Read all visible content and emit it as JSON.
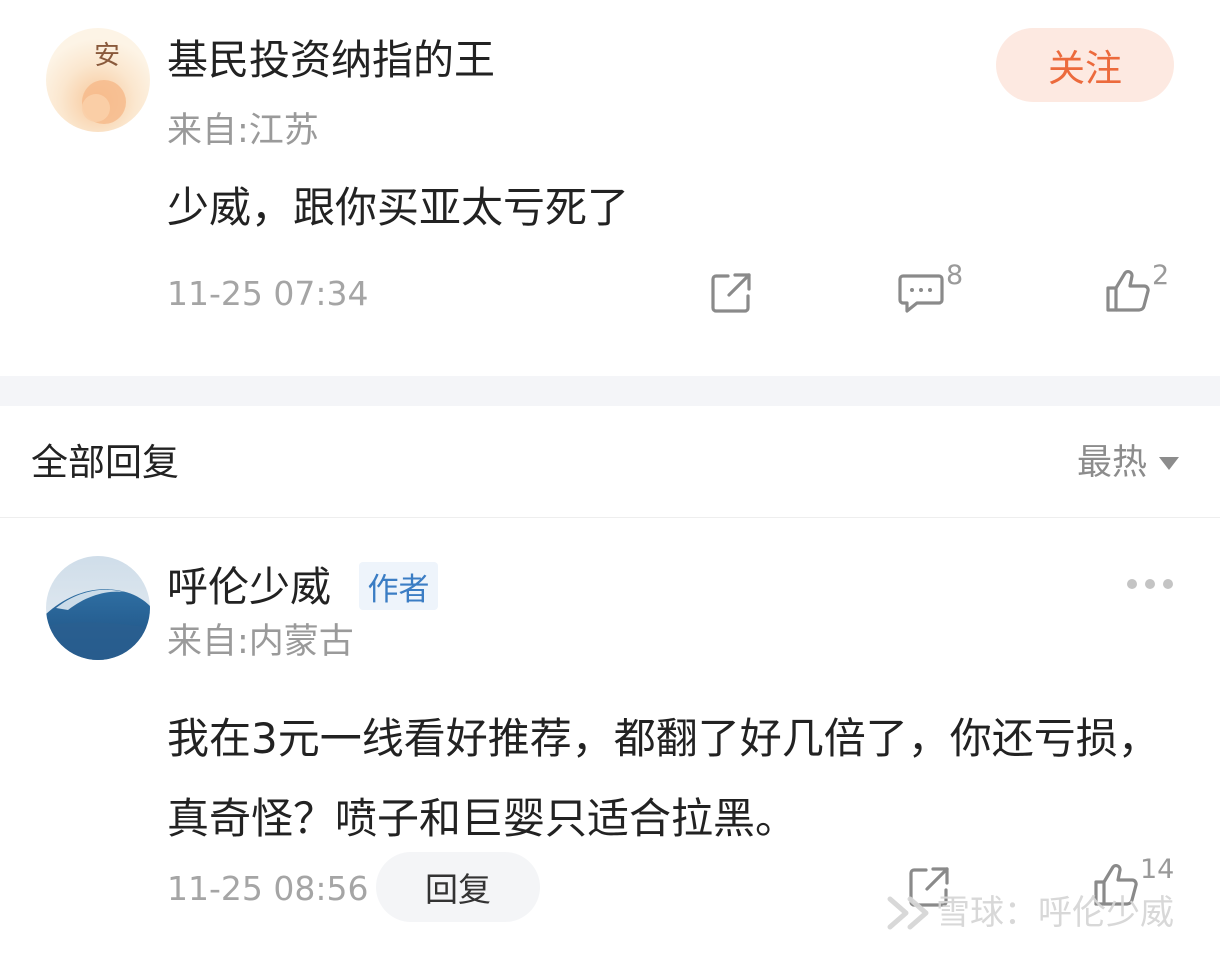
{
  "post": {
    "username": "基民投资纳指的王",
    "follow_label": "关注",
    "location": "来自:江苏",
    "content": "少威，跟你买亚太亏死了",
    "timestamp": "11-25 07:34",
    "comment_count": "8",
    "like_count": "2",
    "avatar_text": "安"
  },
  "replies_header": {
    "title": "全部回复",
    "sort_label": "最热"
  },
  "reply": {
    "username": "呼伦少威",
    "author_badge": "作者",
    "location": "来自:内蒙古",
    "content": "我在3元一线看好推荐，都翻了好几倍了，你还亏损，真奇怪？喷子和巨婴只适合拉黑。",
    "timestamp": "11-25 08:56",
    "reply_label": "回复",
    "like_count": "14"
  },
  "watermark": {
    "text": "雪球：呼伦少威"
  },
  "colors": {
    "follow_bg": "#fde9e1",
    "follow_text": "#ec6a3c",
    "badge_text": "#3b7dc4",
    "separator": "#f4f5f8"
  },
  "icons": [
    "share-icon",
    "comment-icon",
    "like-icon",
    "more-icon",
    "sort-arrow-icon",
    "xueqiu-logo-icon"
  ]
}
